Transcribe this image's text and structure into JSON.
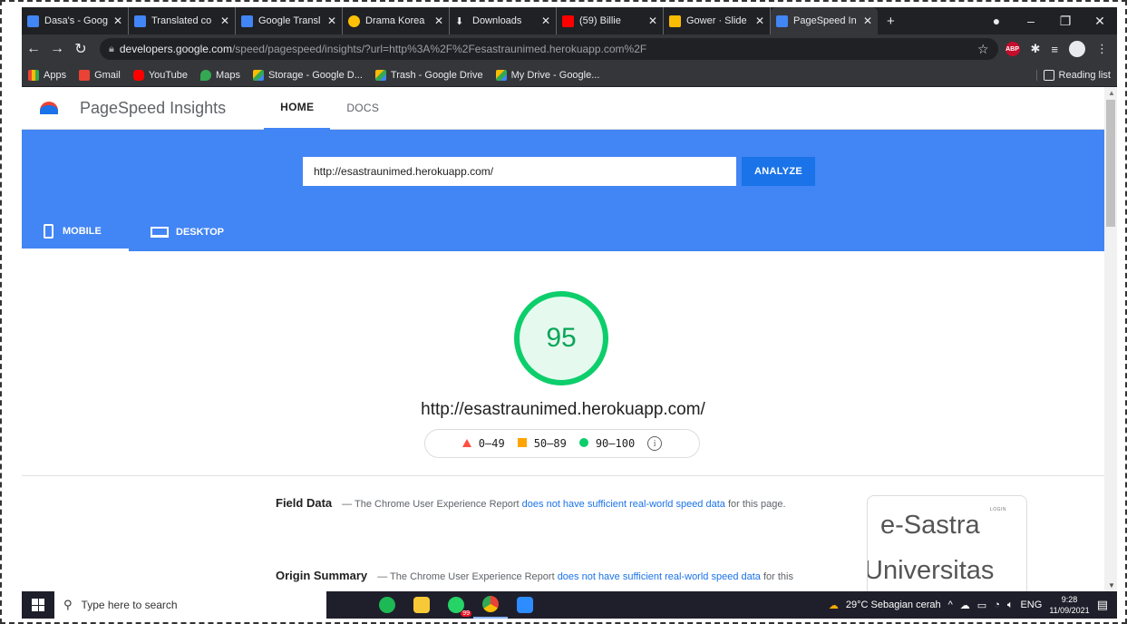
{
  "browser": {
    "tabs": [
      {
        "title": "Dasa's - Goog",
        "color": "#4285f4"
      },
      {
        "title": "Translated co",
        "color": "#4285f4"
      },
      {
        "title": "Google Transl",
        "color": "#4285f4"
      },
      {
        "title": "Drama Korea",
        "color": "#ffc107"
      },
      {
        "title": "Downloads",
        "color": "#e8eaed"
      },
      {
        "title": "(59) Billie",
        "color": "#ff0000"
      },
      {
        "title": "Gower · Slide",
        "color": "#fbbc04"
      },
      {
        "title": "PageSpeed In",
        "color": "#4285f4"
      }
    ],
    "new_tab": "+",
    "address": {
      "host": "developers.google.com",
      "path": "/speed/pagespeed/insights/?url=http%3A%2F%2Fesastraunimed.herokuapp.com%2F"
    },
    "abp_label": "ABP",
    "bookmarks": [
      "Apps",
      "Gmail",
      "YouTube",
      "Maps",
      "Storage - Google D...",
      "Trash - Google Drive",
      "My Drive - Google..."
    ],
    "reading_list": "Reading list"
  },
  "psi": {
    "brand": "PageSpeed Insights",
    "nav": {
      "home": "HOME",
      "docs": "DOCS"
    },
    "url_value": "http://esastraunimed.herokuapp.com/",
    "analyze": "ANALYZE",
    "device_tabs": {
      "mobile": "MOBILE",
      "desktop": "DESKTOP"
    },
    "score": "95",
    "tested_url": "http://esastraunimed.herokuapp.com/",
    "legend": {
      "poor": "0–49",
      "average": "50–89",
      "good": "90–100"
    },
    "field_data": {
      "title": "Field Data",
      "text": " — The Chrome User Experience Report ",
      "link": "does not have sufficient real-world speed data",
      "tail": " for this page."
    },
    "origin_summary": {
      "title": "Origin Summary",
      "text": " — The Chrome User Experience Report ",
      "link": "does not have sufficient real-world speed data",
      "tail": " for this origin."
    },
    "screenshot": {
      "login": "LOGIN",
      "line1": "e-Sastra",
      "line2": "Universitas"
    }
  },
  "taskbar": {
    "search_placeholder": "Type here to search",
    "weather": "29°C  Sebagian cerah",
    "lang": "ENG",
    "time": "9:28",
    "date": "11/09/2021",
    "badge": "99"
  }
}
